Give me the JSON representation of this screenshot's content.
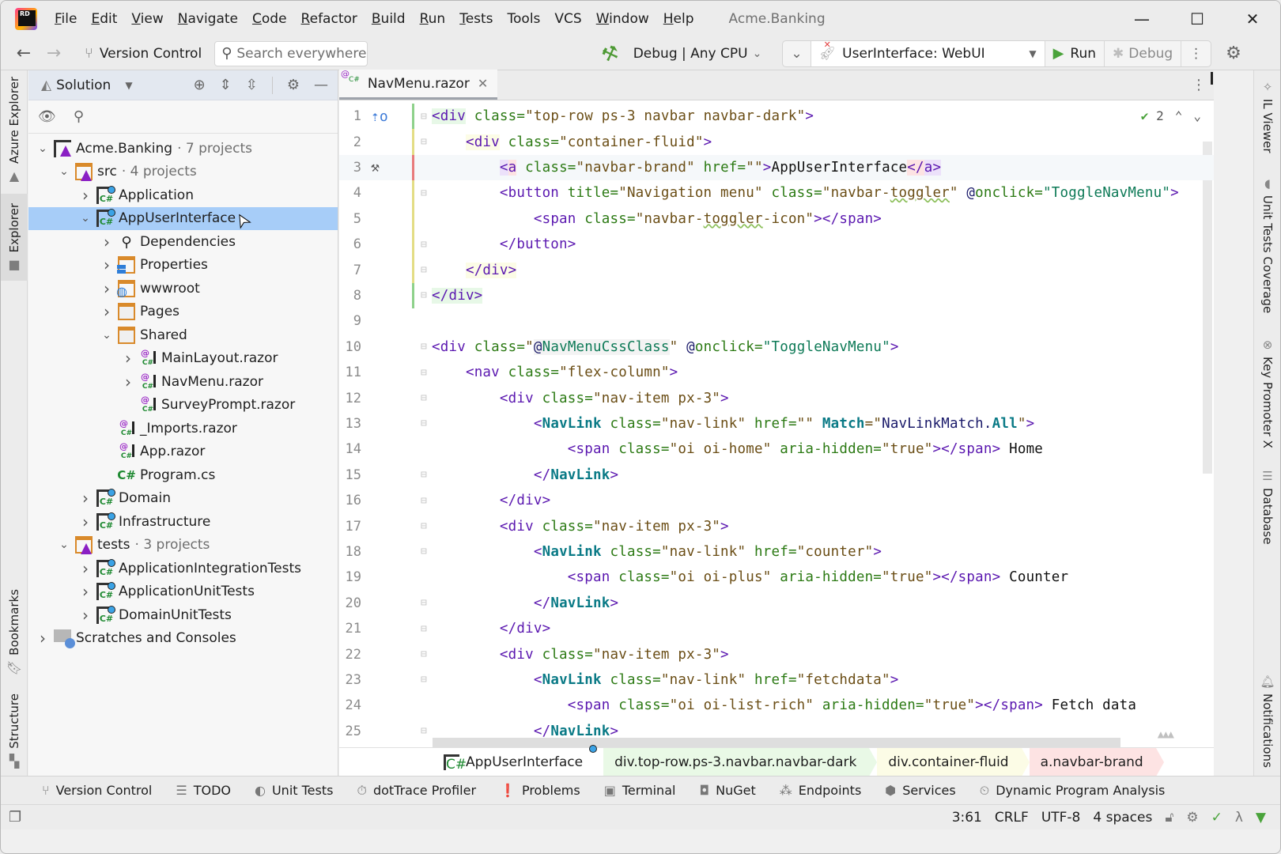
{
  "app": {
    "title": "Acme.Banking",
    "menu": [
      {
        "label": "File",
        "mnemonic": "F",
        "rest": "ile"
      },
      {
        "label": "Edit",
        "mnemonic": "E",
        "rest": "dit"
      },
      {
        "label": "View",
        "mnemonic": "V",
        "rest": "iew"
      },
      {
        "label": "Navigate",
        "mnemonic": "N",
        "rest": "avigate"
      },
      {
        "label": "Code",
        "mnemonic": "C",
        "rest": "ode"
      },
      {
        "label": "Refactor",
        "mnemonic": "R",
        "rest": "efactor"
      },
      {
        "label": "Build",
        "mnemonic": "B",
        "rest": "uild"
      },
      {
        "label": "Run",
        "mnemonic": "R",
        "rest": "un"
      },
      {
        "label": "Tests",
        "mnemonic": "T",
        "rest": "ests"
      },
      {
        "label": "Tools",
        "mnemonic": "",
        "rest": "Tools"
      },
      {
        "label": "VCS",
        "mnemonic": "",
        "rest": "VCS"
      },
      {
        "label": "Window",
        "mnemonic": "W",
        "rest": "indow"
      },
      {
        "label": "Help",
        "mnemonic": "H",
        "rest": "elp"
      }
    ],
    "window_controls": {
      "minimize": "—",
      "maximize": "☐",
      "close": "✕"
    }
  },
  "toolbar": {
    "back": "←",
    "forward": "→",
    "version_control": "Version Control",
    "search_placeholder": "Search everywhere",
    "build_config": "Debug | Any CPU",
    "run_target": "UserInterface: WebUI",
    "run_label": "Run",
    "debug_label": "Debug"
  },
  "left_stripe": {
    "tabs": [
      {
        "label": "Azure Explorer",
        "icon": "azure-icon"
      },
      {
        "label": "Explorer",
        "icon": "folder-icon",
        "active": true
      },
      {
        "label": "Bookmarks",
        "icon": "bookmark-icon"
      },
      {
        "label": "Structure",
        "icon": "structure-icon"
      }
    ]
  },
  "solution_explorer": {
    "view_label": "Solution",
    "tree": [
      {
        "label": "Acme.Banking",
        "suffix": "· 7 projects",
        "icon": "sln",
        "level": 0,
        "state": "expanded"
      },
      {
        "label": "src",
        "suffix": "· 4 projects",
        "icon": "slnf",
        "level": 1,
        "state": "expanded"
      },
      {
        "label": "Application",
        "icon": "csproj",
        "level": 2,
        "state": "collapsed"
      },
      {
        "label": "AppUserInterface",
        "icon": "csproj",
        "level": 2,
        "state": "expanded",
        "selected": true
      },
      {
        "label": "Dependencies",
        "icon": "deps",
        "level": 3,
        "state": "collapsed"
      },
      {
        "label": "Properties",
        "icon": "props",
        "level": 3,
        "state": "collapsed"
      },
      {
        "label": "wwwroot",
        "icon": "web",
        "level": 3,
        "state": "collapsed"
      },
      {
        "label": "Pages",
        "icon": "folder",
        "level": 3,
        "state": "collapsed"
      },
      {
        "label": "Shared",
        "icon": "folder",
        "level": 3,
        "state": "expanded"
      },
      {
        "label": "MainLayout.razor",
        "icon": "razor",
        "level": 4,
        "state": "collapsed"
      },
      {
        "label": "NavMenu.razor",
        "icon": "razor",
        "level": 4,
        "state": "collapsed"
      },
      {
        "label": "SurveyPrompt.razor",
        "icon": "razor",
        "level": 4,
        "state": "none"
      },
      {
        "label": "_Imports.razor",
        "icon": "razor",
        "level": 3,
        "state": "none"
      },
      {
        "label": "App.razor",
        "icon": "razor",
        "level": 3,
        "state": "none"
      },
      {
        "label": "Program.cs",
        "icon": "cs",
        "level": 3,
        "state": "none"
      },
      {
        "label": "Domain",
        "icon": "csproj",
        "level": 2,
        "state": "collapsed"
      },
      {
        "label": "Infrastructure",
        "icon": "csproj",
        "level": 2,
        "state": "collapsed"
      },
      {
        "label": "tests",
        "suffix": "· 3 projects",
        "icon": "slnf",
        "level": 1,
        "state": "expanded"
      },
      {
        "label": "ApplicationIntegrationTests",
        "icon": "csproj",
        "level": 2,
        "state": "collapsed"
      },
      {
        "label": "ApplicationUnitTests",
        "icon": "csproj",
        "level": 2,
        "state": "collapsed"
      },
      {
        "label": "DomainUnitTests",
        "icon": "csproj",
        "level": 2,
        "state": "collapsed"
      },
      {
        "label": "Scratches and Consoles",
        "icon": "scratch",
        "level": 0,
        "state": "collapsed"
      }
    ]
  },
  "editor": {
    "tab": {
      "label": "NavMenu.razor",
      "close": "✕"
    },
    "inspection_count": "2",
    "cursor_line": 3,
    "lines": [
      {
        "n": "1",
        "tokens": [
          [
            "tag hl-g",
            "<div"
          ],
          [
            "attr",
            " class="
          ],
          [
            "str",
            "\"top-row ps-3 navbar navbar-dark\""
          ],
          [
            "tag",
            ">"
          ]
        ]
      },
      {
        "n": "2",
        "tokens": [
          [
            "txt",
            "    "
          ],
          [
            "tag hl-y",
            "<div"
          ],
          [
            "attr",
            " class="
          ],
          [
            "str",
            "\"container-fluid\""
          ],
          [
            "tag",
            ">"
          ]
        ]
      },
      {
        "n": "3",
        "tokens": [
          [
            "txt",
            "        "
          ],
          [
            "tag hl-p",
            "<"
          ],
          [
            "tag hl-r",
            "a"
          ],
          [
            "attr",
            " class="
          ],
          [
            "str",
            "\"navbar-brand\""
          ],
          [
            "attr",
            " href="
          ],
          [
            "str",
            "\"\""
          ],
          [
            "tag",
            ">"
          ],
          [
            "txt",
            "AppUserInterface"
          ],
          [
            "tag hl-r",
            "</"
          ],
          [
            "tag hl-p",
            "a>"
          ]
        ]
      },
      {
        "n": "4",
        "tokens": [
          [
            "txt",
            "        "
          ],
          [
            "tag",
            "<button"
          ],
          [
            "attr",
            " title="
          ],
          [
            "str",
            "\"Navigation menu\""
          ],
          [
            "attr",
            " class="
          ],
          [
            "str",
            "\"navbar-"
          ],
          [
            "str wavy",
            "toggler"
          ],
          [
            "str",
            "\""
          ],
          [
            "razorv",
            " @"
          ],
          [
            "attr",
            "onclick="
          ],
          [
            "val",
            "\"ToggleNavMenu\""
          ],
          [
            "tag",
            ">"
          ]
        ]
      },
      {
        "n": "5",
        "tokens": [
          [
            "txt",
            "            "
          ],
          [
            "tag",
            "<span"
          ],
          [
            "attr",
            " class="
          ],
          [
            "str",
            "\"navbar-"
          ],
          [
            "str wavy",
            "toggler"
          ],
          [
            "str",
            "-icon\""
          ],
          [
            "tag",
            "></span>"
          ]
        ]
      },
      {
        "n": "6",
        "tokens": [
          [
            "txt",
            "        "
          ],
          [
            "tag",
            "</button>"
          ]
        ]
      },
      {
        "n": "7",
        "tokens": [
          [
            "txt",
            "    "
          ],
          [
            "tag hl-y",
            "</div>"
          ]
        ]
      },
      {
        "n": "8",
        "tokens": [
          [
            "tag hl-g",
            "</div>"
          ]
        ]
      },
      {
        "n": "9",
        "tokens": []
      },
      {
        "n": "10",
        "tokens": [
          [
            "tag",
            "<div"
          ],
          [
            "attr",
            " class="
          ],
          [
            "str",
            "\""
          ],
          [
            "razorv hl-gray",
            "@"
          ],
          [
            "val hl-gray",
            "NavMenuCssClass"
          ],
          [
            "str",
            "\""
          ],
          [
            "razorv",
            " @"
          ],
          [
            "attr",
            "onclick="
          ],
          [
            "val",
            "\"ToggleNavMenu\""
          ],
          [
            "tag",
            ">"
          ]
        ]
      },
      {
        "n": "11",
        "tokens": [
          [
            "txt",
            "    "
          ],
          [
            "tag",
            "<nav"
          ],
          [
            "attr",
            " class="
          ],
          [
            "str",
            "\"flex-column\""
          ],
          [
            "tag",
            ">"
          ]
        ]
      },
      {
        "n": "12",
        "tokens": [
          [
            "txt",
            "        "
          ],
          [
            "tag",
            "<div"
          ],
          [
            "attr",
            " class="
          ],
          [
            "str",
            "\"nav-item px-3\""
          ],
          [
            "tag",
            ">"
          ]
        ]
      },
      {
        "n": "13",
        "tokens": [
          [
            "txt",
            "            "
          ],
          [
            "tag",
            "<"
          ],
          [
            "comp",
            "NavLink"
          ],
          [
            "attr",
            " class="
          ],
          [
            "str",
            "\"nav-link\""
          ],
          [
            "attr",
            " href="
          ],
          [
            "str",
            "\"\""
          ],
          [
            "comp",
            " Match"
          ],
          [
            "str",
            "=\""
          ],
          [
            "razorv",
            "NavLinkMatch."
          ],
          [
            "comp",
            "All"
          ],
          [
            "str",
            "\""
          ],
          [
            "tag",
            ">"
          ]
        ]
      },
      {
        "n": "14",
        "tokens": [
          [
            "txt",
            "                "
          ],
          [
            "tag",
            "<span"
          ],
          [
            "attr",
            " class="
          ],
          [
            "str",
            "\"oi oi-home\""
          ],
          [
            "attr",
            " aria-hidden="
          ],
          [
            "str",
            "\"true\""
          ],
          [
            "tag",
            "></span>"
          ],
          [
            "txt",
            " Home"
          ]
        ]
      },
      {
        "n": "15",
        "tokens": [
          [
            "txt",
            "            "
          ],
          [
            "tag",
            "</"
          ],
          [
            "comp",
            "NavLink"
          ],
          [
            "tag",
            ">"
          ]
        ]
      },
      {
        "n": "16",
        "tokens": [
          [
            "txt",
            "        "
          ],
          [
            "tag",
            "</div>"
          ]
        ]
      },
      {
        "n": "17",
        "tokens": [
          [
            "txt",
            "        "
          ],
          [
            "tag",
            "<div"
          ],
          [
            "attr",
            " class="
          ],
          [
            "str",
            "\"nav-item px-3\""
          ],
          [
            "tag",
            ">"
          ]
        ]
      },
      {
        "n": "18",
        "tokens": [
          [
            "txt",
            "            "
          ],
          [
            "tag",
            "<"
          ],
          [
            "comp",
            "NavLink"
          ],
          [
            "attr",
            " class="
          ],
          [
            "str",
            "\"nav-link\""
          ],
          [
            "attr",
            " href="
          ],
          [
            "str",
            "\"counter\""
          ],
          [
            "tag",
            ">"
          ]
        ]
      },
      {
        "n": "19",
        "tokens": [
          [
            "txt",
            "                "
          ],
          [
            "tag",
            "<span"
          ],
          [
            "attr",
            " class="
          ],
          [
            "str",
            "\"oi oi-plus\""
          ],
          [
            "attr",
            " aria-hidden="
          ],
          [
            "str",
            "\"true\""
          ],
          [
            "tag",
            "></span>"
          ],
          [
            "txt",
            " Counter"
          ]
        ]
      },
      {
        "n": "20",
        "tokens": [
          [
            "txt",
            "            "
          ],
          [
            "tag",
            "</"
          ],
          [
            "comp",
            "NavLink"
          ],
          [
            "tag",
            ">"
          ]
        ]
      },
      {
        "n": "21",
        "tokens": [
          [
            "txt",
            "        "
          ],
          [
            "tag",
            "</div>"
          ]
        ]
      },
      {
        "n": "22",
        "tokens": [
          [
            "txt",
            "        "
          ],
          [
            "tag",
            "<div"
          ],
          [
            "attr",
            " class="
          ],
          [
            "str",
            "\"nav-item px-3\""
          ],
          [
            "tag",
            ">"
          ]
        ]
      },
      {
        "n": "23",
        "tokens": [
          [
            "txt",
            "            "
          ],
          [
            "tag",
            "<"
          ],
          [
            "comp",
            "NavLink"
          ],
          [
            "attr",
            " class="
          ],
          [
            "str",
            "\"nav-link\""
          ],
          [
            "attr",
            " href="
          ],
          [
            "str",
            "\"fetchdata\""
          ],
          [
            "tag",
            ">"
          ]
        ]
      },
      {
        "n": "24",
        "tokens": [
          [
            "txt",
            "                "
          ],
          [
            "tag",
            "<span"
          ],
          [
            "attr",
            " class="
          ],
          [
            "str",
            "\"oi oi-list-rich\""
          ],
          [
            "attr",
            " aria-hidden="
          ],
          [
            "str",
            "\"true\""
          ],
          [
            "tag",
            "></span>"
          ],
          [
            "txt",
            " Fetch data"
          ]
        ]
      },
      {
        "n": "25",
        "tokens": [
          [
            "txt",
            "            "
          ],
          [
            "tag",
            "</"
          ],
          [
            "comp",
            "NavLink"
          ],
          [
            "tag",
            ">"
          ]
        ]
      }
    ],
    "breadcrumbs": [
      {
        "label": "AppUserInterface",
        "kind": "project"
      },
      {
        "label": "div.top-row.ps-3.navbar.navbar-dark",
        "kind": "g"
      },
      {
        "label": "div.container-fluid",
        "kind": "y"
      },
      {
        "label": "a.navbar-brand",
        "kind": "r"
      }
    ]
  },
  "right_stripe": {
    "tabs": [
      {
        "label": "IL Viewer",
        "icon": "il-viewer-icon"
      },
      {
        "label": "Unit Tests Coverage",
        "icon": "coverage-icon"
      },
      {
        "label": "Key Promoter X",
        "icon": "key-promoter-icon"
      },
      {
        "label": "Database",
        "icon": "database-icon"
      },
      {
        "label": "Notifications",
        "icon": "bell-icon"
      }
    ]
  },
  "tool_windows": [
    {
      "label": "Version Control",
      "icon": "⑂"
    },
    {
      "label": "TODO",
      "icon": "☰"
    },
    {
      "label": "Unit Tests",
      "icon": "◐"
    },
    {
      "label": "dotTrace Profiler",
      "icon": "⏱"
    },
    {
      "label": "Problems",
      "icon": "❗"
    },
    {
      "label": "Terminal",
      "icon": "▣"
    },
    {
      "label": "NuGet",
      "icon": "◘"
    },
    {
      "label": "Endpoints",
      "icon": "⁂"
    },
    {
      "label": "Services",
      "icon": "⬢"
    },
    {
      "label": "Dynamic Program Analysis",
      "icon": "⏲"
    }
  ],
  "status": {
    "position": "3:61",
    "line_separator": "CRLF",
    "encoding": "UTF-8",
    "indent": "4 spaces"
  }
}
